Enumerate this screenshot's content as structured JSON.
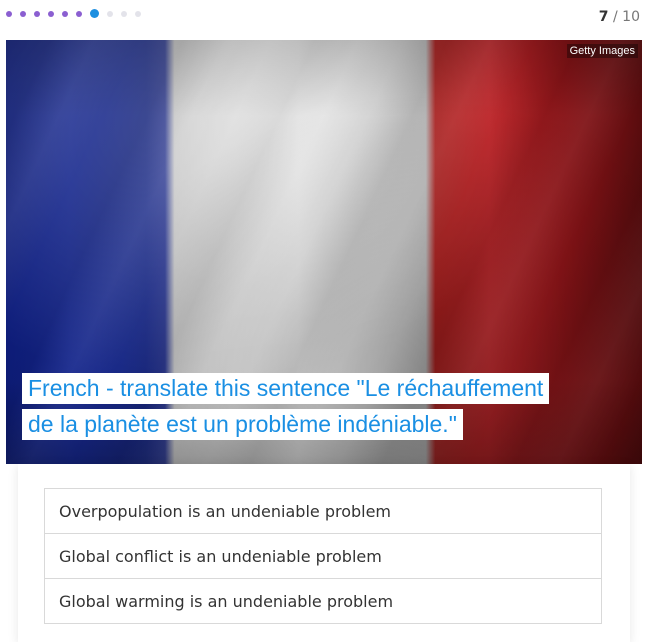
{
  "progress": {
    "total": 10,
    "current": 7,
    "current_label": "7",
    "separator": " / ",
    "total_label": "10",
    "colors": {
      "done": "#8b5fd1",
      "current": "#1e8fe0",
      "pending": "#e3e3ea"
    }
  },
  "image": {
    "subject": "french-flag",
    "credit": "Getty Images"
  },
  "question": {
    "line1": "French - translate this sentence \"Le réchauffement",
    "line2": "de la planète est un problème indéniable.\"",
    "color": "#1a8fe3"
  },
  "answers": [
    {
      "label": "Overpopulation is an undeniable problem"
    },
    {
      "label": "Global conflict is an undeniable problem"
    },
    {
      "label": "Global warming is an undeniable problem"
    }
  ]
}
